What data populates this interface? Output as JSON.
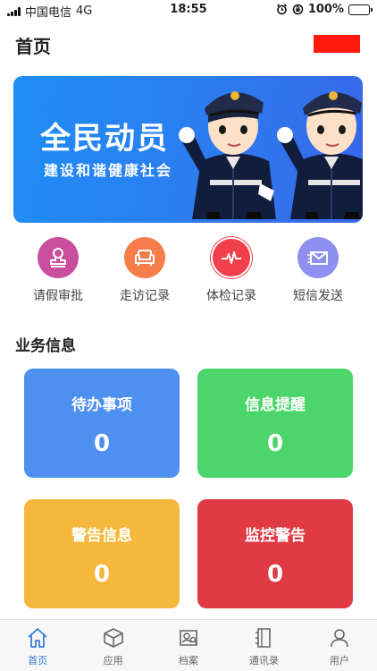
{
  "status_bar": {
    "carrier": "中国电信",
    "network": "4G",
    "time": "18:55",
    "battery": "100%"
  },
  "header": {
    "title": "首页"
  },
  "banner": {
    "title": "全民动员",
    "subtitle": "建设和谐健康社会"
  },
  "quick_actions": [
    {
      "label": "请假审批",
      "icon": "stamp-icon",
      "color": "#c94f9e"
    },
    {
      "label": "走访记录",
      "icon": "sofa-icon",
      "color": "#f57d4a"
    },
    {
      "label": "体检记录",
      "icon": "heartbeat-icon",
      "color": "#f2404a"
    },
    {
      "label": "短信发送",
      "icon": "message-icon",
      "color": "#8f8ff2"
    }
  ],
  "section": {
    "title": "业务信息"
  },
  "cards": [
    {
      "title": "待办事项",
      "value": "0",
      "color": "#4d90f0"
    },
    {
      "title": "信息提醒",
      "value": "0",
      "color": "#4bd56b"
    },
    {
      "title": "警告信息",
      "value": "0",
      "color": "#f5b83d"
    },
    {
      "title": "监控警告",
      "value": "0",
      "color": "#e03b45"
    }
  ],
  "tabs": [
    {
      "label": "首页",
      "icon": "home-icon",
      "active": true
    },
    {
      "label": "应用",
      "icon": "cube-icon",
      "active": false
    },
    {
      "label": "档案",
      "icon": "archive-search-icon",
      "active": false
    },
    {
      "label": "通讯录",
      "icon": "contacts-book-icon",
      "active": false
    },
    {
      "label": "用户",
      "icon": "user-icon",
      "active": false
    }
  ],
  "colors": {
    "accent": "#3a7bd5",
    "banner_start": "#1f8ef5",
    "banner_end": "#3866e8"
  }
}
